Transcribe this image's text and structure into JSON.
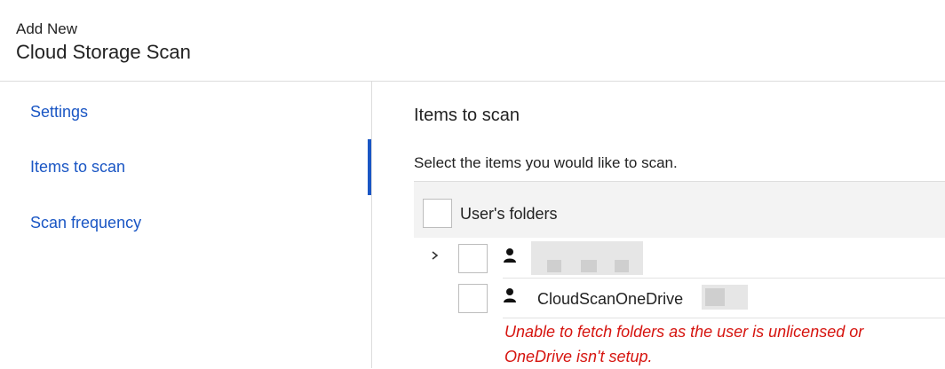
{
  "header": {
    "subtitle": "Add New",
    "title": "Cloud Storage Scan"
  },
  "sidebar": {
    "items": [
      {
        "label": "Settings"
      },
      {
        "label": "Items to scan",
        "active": true
      },
      {
        "label": "Scan frequency"
      }
    ]
  },
  "main": {
    "heading": "Items to scan",
    "description": "Select the items you would like to scan.",
    "table": {
      "header_label": "User's folders",
      "rows": [
        {
          "label": "",
          "redacted": true,
          "expandable": true,
          "icon": "user-icon"
        },
        {
          "label": "CloudScanOneDrive",
          "redacted_suffix": true,
          "expandable": false,
          "icon": "user-icon"
        }
      ]
    },
    "error_message": "Unable to fetch folders as the user is unlicensed or OneDrive isn't setup."
  },
  "colors": {
    "link": "#1a56c4",
    "error": "#d6140f",
    "header_bg": "#f3f3f3"
  }
}
